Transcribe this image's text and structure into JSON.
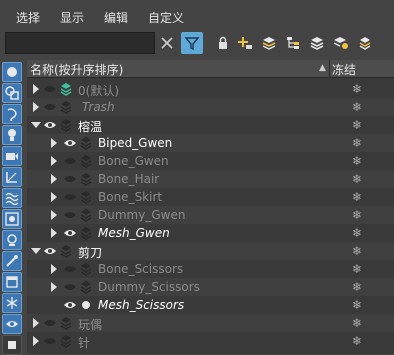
{
  "menu": [
    "选择",
    "显示",
    "编辑",
    "自定义"
  ],
  "toolbar": {
    "search_value": "",
    "icons": [
      "close-icon",
      "filter-icon",
      "lock-icon",
      "add-to-layer-icon",
      "layers-icon",
      "hierarchy-icon",
      "layer-stack-icon",
      "layer-settings-icon",
      "freeze-icon"
    ]
  },
  "leftbar_icons": [
    "display-all-icon",
    "geometry-icon",
    "shapes-icon",
    "lights-icon",
    "cameras-icon",
    "helpers-icon",
    "spacewarps-icon",
    "groups-icon",
    "xrefs-icon",
    "bones-icon",
    "containers-icon",
    "frozen-icon",
    "hidden-icon",
    "extra-icon"
  ],
  "header": {
    "name_col": "名称(按升序排序)",
    "sort_arrow": "▲",
    "freeze_col": "冻结"
  },
  "freeze_glyph": "❄",
  "rows": [
    {
      "label": "0(默认)",
      "style": "dim"
    },
    {
      "label": "Trash",
      "style": "dim"
    },
    {
      "label": "榕温",
      "style": "bright"
    },
    {
      "label": "Biped_Gwen",
      "style": "bright"
    },
    {
      "label": "Bone_Gwen",
      "style": "dim"
    },
    {
      "label": "Bone_Hair",
      "style": "dim"
    },
    {
      "label": "Bone_Skirt",
      "style": "dim"
    },
    {
      "label": "Dummy_Gwen",
      "style": "dim"
    },
    {
      "label": "Mesh_Gwen",
      "style": "bright"
    },
    {
      "label": "剪刀",
      "style": "bright"
    },
    {
      "label": "Bone_Scissors",
      "style": "dim"
    },
    {
      "label": "Dummy_Scissors",
      "style": "dim"
    },
    {
      "label": "Mesh_Scissors",
      "style": "bright"
    },
    {
      "label": "玩偶",
      "style": "dim"
    },
    {
      "label": "针",
      "style": "dim"
    }
  ]
}
